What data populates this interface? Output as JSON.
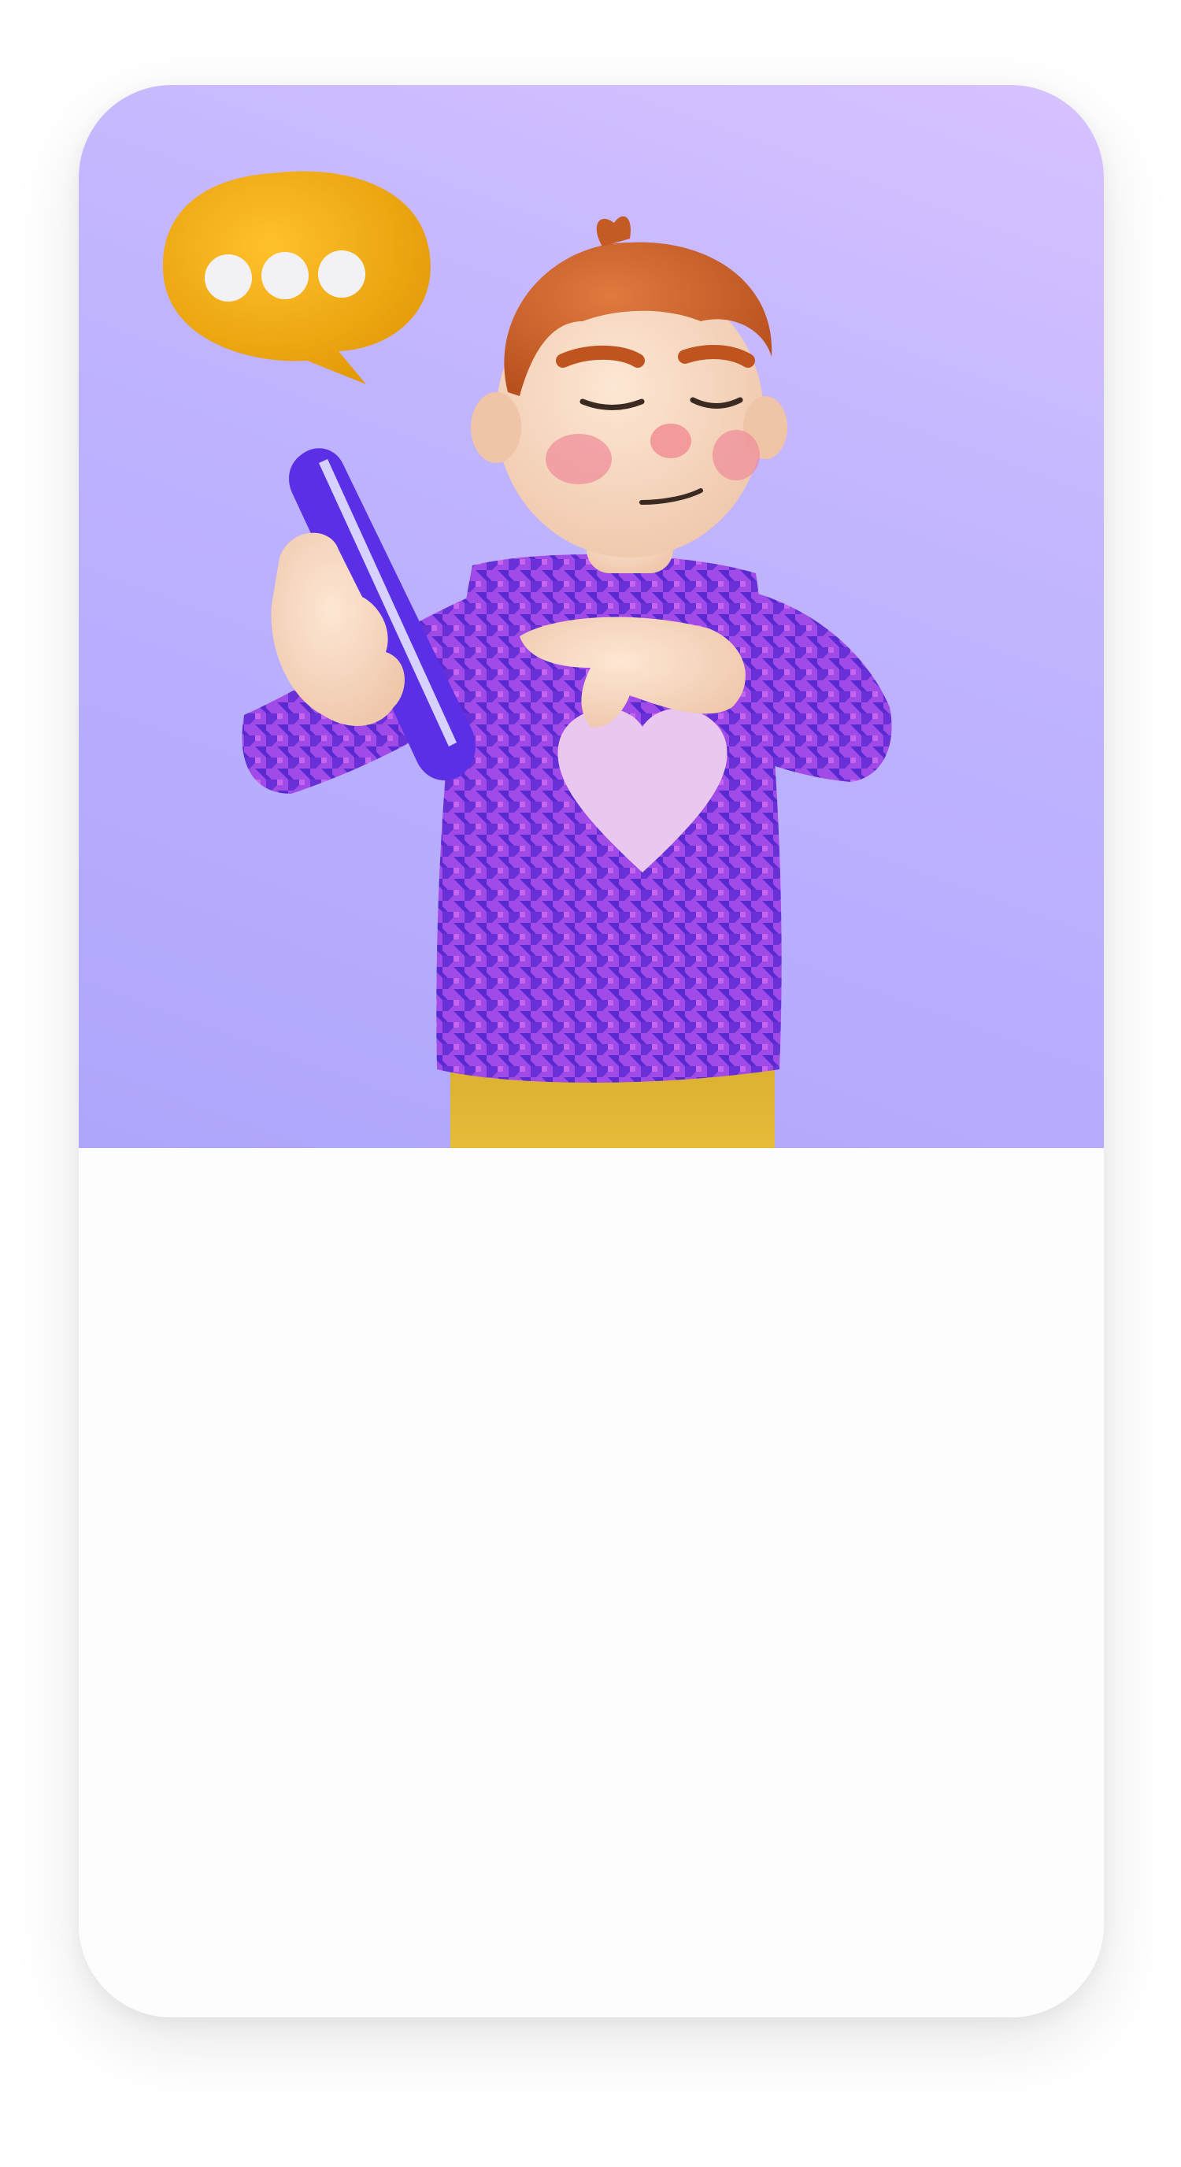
{
  "card": {
    "illustration": {
      "subject": "3d-character-texting",
      "background_colors": [
        "#d7c2ff",
        "#c0b4ff",
        "#aea6fb"
      ],
      "bubble_color": "#f1a90e",
      "sweater_color": "#8a3fe0",
      "pants_color": "#e2b733",
      "phone_color": "#5b2fe6"
    }
  }
}
